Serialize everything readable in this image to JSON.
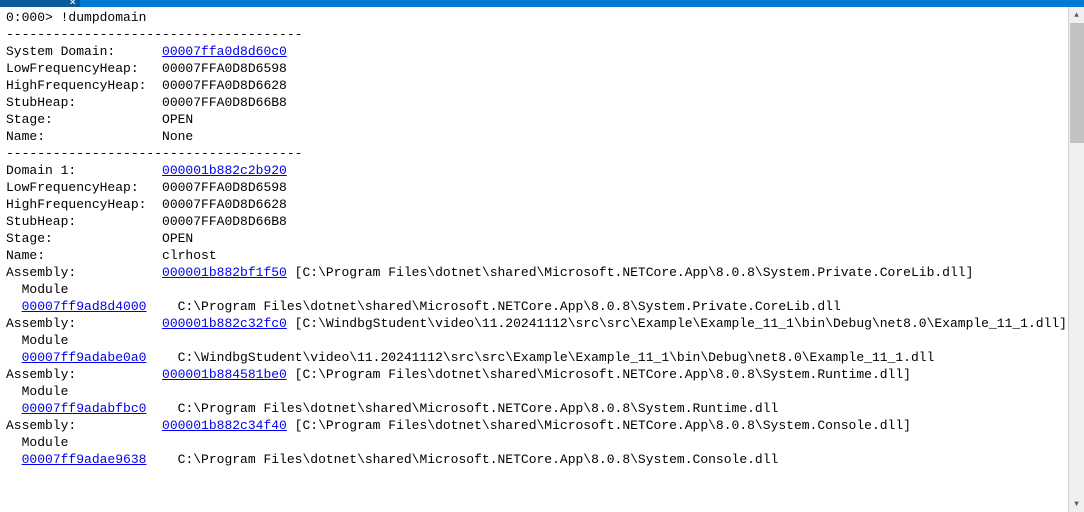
{
  "prompt": "0:000> ",
  "command": "!dumpdomain",
  "divider": "--------------------------------------",
  "system": {
    "titleLabel": "System Domain:",
    "titleLink": "00007ffa0d8d60c0",
    "rows": [
      {
        "label": "LowFrequencyHeap:",
        "value": "00007FFA0D8D6598"
      },
      {
        "label": "HighFrequencyHeap:",
        "value": "00007FFA0D8D6628"
      },
      {
        "label": "StubHeap:",
        "value": "00007FFA0D8D66B8"
      },
      {
        "label": "Stage:",
        "value": "OPEN"
      },
      {
        "label": "Name:",
        "value": "None"
      }
    ]
  },
  "domain1": {
    "titleLabel": "Domain 1:",
    "titleLink": "000001b882c2b920",
    "rows": [
      {
        "label": "LowFrequencyHeap:",
        "value": "00007FFA0D8D6598"
      },
      {
        "label": "HighFrequencyHeap:",
        "value": "00007FFA0D8D6628"
      },
      {
        "label": "StubHeap:",
        "value": "00007FFA0D8D66B8"
      },
      {
        "label": "Stage:",
        "value": "OPEN"
      },
      {
        "label": "Name:",
        "value": "clrhost"
      }
    ],
    "assemblies": [
      {
        "label": "Assembly:",
        "link": "000001b882bf1f50",
        "path": " [C:\\Program Files\\dotnet\\shared\\Microsoft.NETCore.App\\8.0.8\\System.Private.CoreLib.dll]",
        "moduleLabel": "  Module",
        "modLink": "00007ff9ad8d4000",
        "modPath": "    C:\\Program Files\\dotnet\\shared\\Microsoft.NETCore.App\\8.0.8\\System.Private.CoreLib.dll"
      },
      {
        "label": "Assembly:",
        "link": "000001b882c32fc0",
        "path": " [C:\\WindbgStudent\\video\\11.20241112\\src\\src\\Example\\Example_11_1\\bin\\Debug\\net8.0\\Example_11_1.dll]",
        "moduleLabel": "  Module",
        "modLink": "00007ff9adabe0a0",
        "modPath": "    C:\\WindbgStudent\\video\\11.20241112\\src\\src\\Example\\Example_11_1\\bin\\Debug\\net8.0\\Example_11_1.dll"
      },
      {
        "label": "Assembly:",
        "link": "000001b884581be0",
        "path": " [C:\\Program Files\\dotnet\\shared\\Microsoft.NETCore.App\\8.0.8\\System.Runtime.dll]",
        "moduleLabel": "  Module",
        "modLink": "00007ff9adabfbc0",
        "modPath": "    C:\\Program Files\\dotnet\\shared\\Microsoft.NETCore.App\\8.0.8\\System.Runtime.dll"
      },
      {
        "label": "Assembly:",
        "link": "000001b882c34f40",
        "path": " [C:\\Program Files\\dotnet\\shared\\Microsoft.NETCore.App\\8.0.8\\System.Console.dll]",
        "moduleLabel": "  Module",
        "modLink": "00007ff9adae9638",
        "modPath": "    C:\\Program Files\\dotnet\\shared\\Microsoft.NETCore.App\\8.0.8\\System.Console.dll"
      }
    ]
  },
  "labelPad": 20,
  "modLinkIndent": "  ",
  "blank": ""
}
